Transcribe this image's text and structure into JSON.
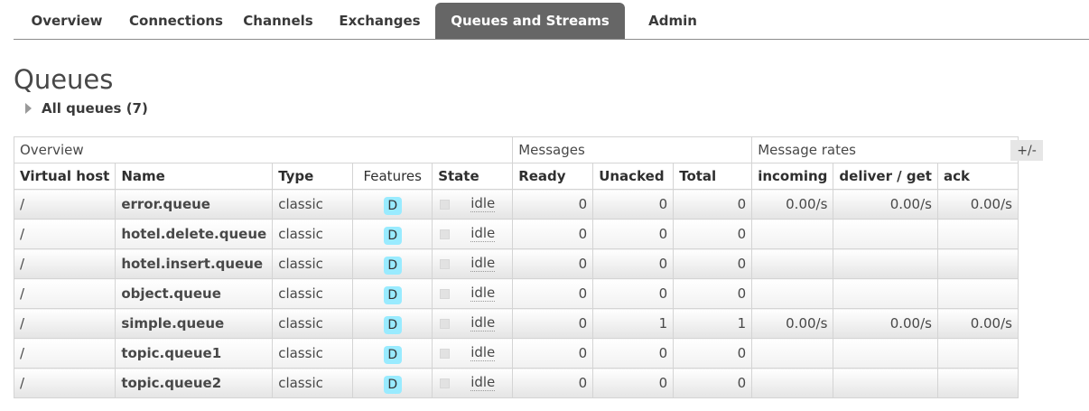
{
  "nav": {
    "tabs": [
      {
        "label": "Overview",
        "active": false
      },
      {
        "label": "Connections",
        "active": false
      },
      {
        "label": "Channels",
        "active": false
      },
      {
        "label": "Exchanges",
        "active": false
      },
      {
        "label": "Queues and Streams",
        "active": true
      },
      {
        "label": "Admin",
        "active": false
      }
    ]
  },
  "page": {
    "title": "Queues",
    "section_label": "All queues (7)"
  },
  "table": {
    "groups": {
      "overview": "Overview",
      "messages": "Messages",
      "rates": "Message rates"
    },
    "columns": {
      "vhost": "Virtual host",
      "name": "Name",
      "type": "Type",
      "features": "Features",
      "state": "State",
      "ready": "Ready",
      "unacked": "Unacked",
      "total": "Total",
      "incoming": "incoming",
      "deliver": "deliver / get",
      "ack": "ack"
    },
    "column_toggle": "+/-",
    "rows": [
      {
        "vhost": "/",
        "name": "error.queue",
        "type": "classic",
        "feature": "D",
        "state": "idle",
        "ready": "0",
        "unacked": "0",
        "total": "0",
        "incoming": "0.00/s",
        "deliver": "0.00/s",
        "ack": "0.00/s"
      },
      {
        "vhost": "/",
        "name": "hotel.delete.queue",
        "type": "classic",
        "feature": "D",
        "state": "idle",
        "ready": "0",
        "unacked": "0",
        "total": "0",
        "incoming": "",
        "deliver": "",
        "ack": ""
      },
      {
        "vhost": "/",
        "name": "hotel.insert.queue",
        "type": "classic",
        "feature": "D",
        "state": "idle",
        "ready": "0",
        "unacked": "0",
        "total": "0",
        "incoming": "",
        "deliver": "",
        "ack": ""
      },
      {
        "vhost": "/",
        "name": "object.queue",
        "type": "classic",
        "feature": "D",
        "state": "idle",
        "ready": "0",
        "unacked": "0",
        "total": "0",
        "incoming": "",
        "deliver": "",
        "ack": ""
      },
      {
        "vhost": "/",
        "name": "simple.queue",
        "type": "classic",
        "feature": "D",
        "state": "idle",
        "ready": "0",
        "unacked": "1",
        "total": "1",
        "incoming": "0.00/s",
        "deliver": "0.00/s",
        "ack": "0.00/s"
      },
      {
        "vhost": "/",
        "name": "topic.queue1",
        "type": "classic",
        "feature": "D",
        "state": "idle",
        "ready": "0",
        "unacked": "0",
        "total": "0",
        "incoming": "",
        "deliver": "",
        "ack": ""
      },
      {
        "vhost": "/",
        "name": "topic.queue2",
        "type": "classic",
        "feature": "D",
        "state": "idle",
        "ready": "0",
        "unacked": "0",
        "total": "0",
        "incoming": "",
        "deliver": "",
        "ack": ""
      }
    ]
  },
  "colors": {
    "active_tab_bg": "#666666",
    "badge_bg": "#99ebff",
    "text": "#484848"
  },
  "icons": {
    "section_toggle": "triangle-right-icon",
    "state": "state-square-icon"
  }
}
